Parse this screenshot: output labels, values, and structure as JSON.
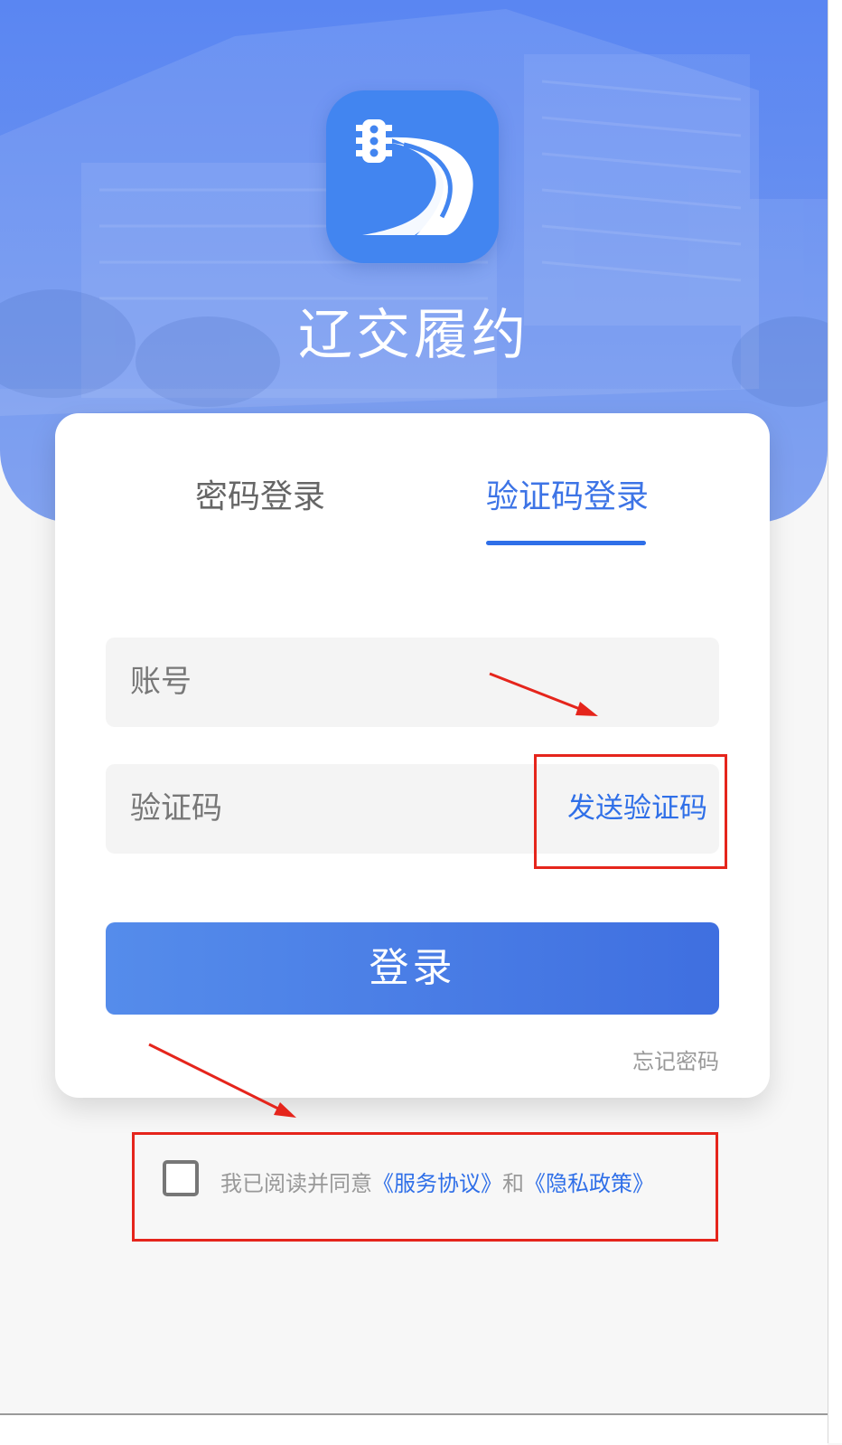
{
  "app": {
    "title": "辽交履约"
  },
  "tabs": [
    {
      "label": "密码登录",
      "active": false
    },
    {
      "label": "验证码登录",
      "active": true
    }
  ],
  "form": {
    "account_placeholder": "账号",
    "code_placeholder": "验证码",
    "send_code_label": "发送验证码",
    "login_label": "登录",
    "forgot_label": "忘记密码"
  },
  "agreement": {
    "checked": false,
    "prefix": "我已阅读并同意",
    "service_link": "《服务协议》",
    "and": "和",
    "privacy_link": "《隐私政策》"
  },
  "colors": {
    "brand": "#2f6fe8",
    "hero": "#5a86f2",
    "annotation": "#e5251c"
  },
  "icons": [
    "traffic-light-icon",
    "road-icon"
  ]
}
